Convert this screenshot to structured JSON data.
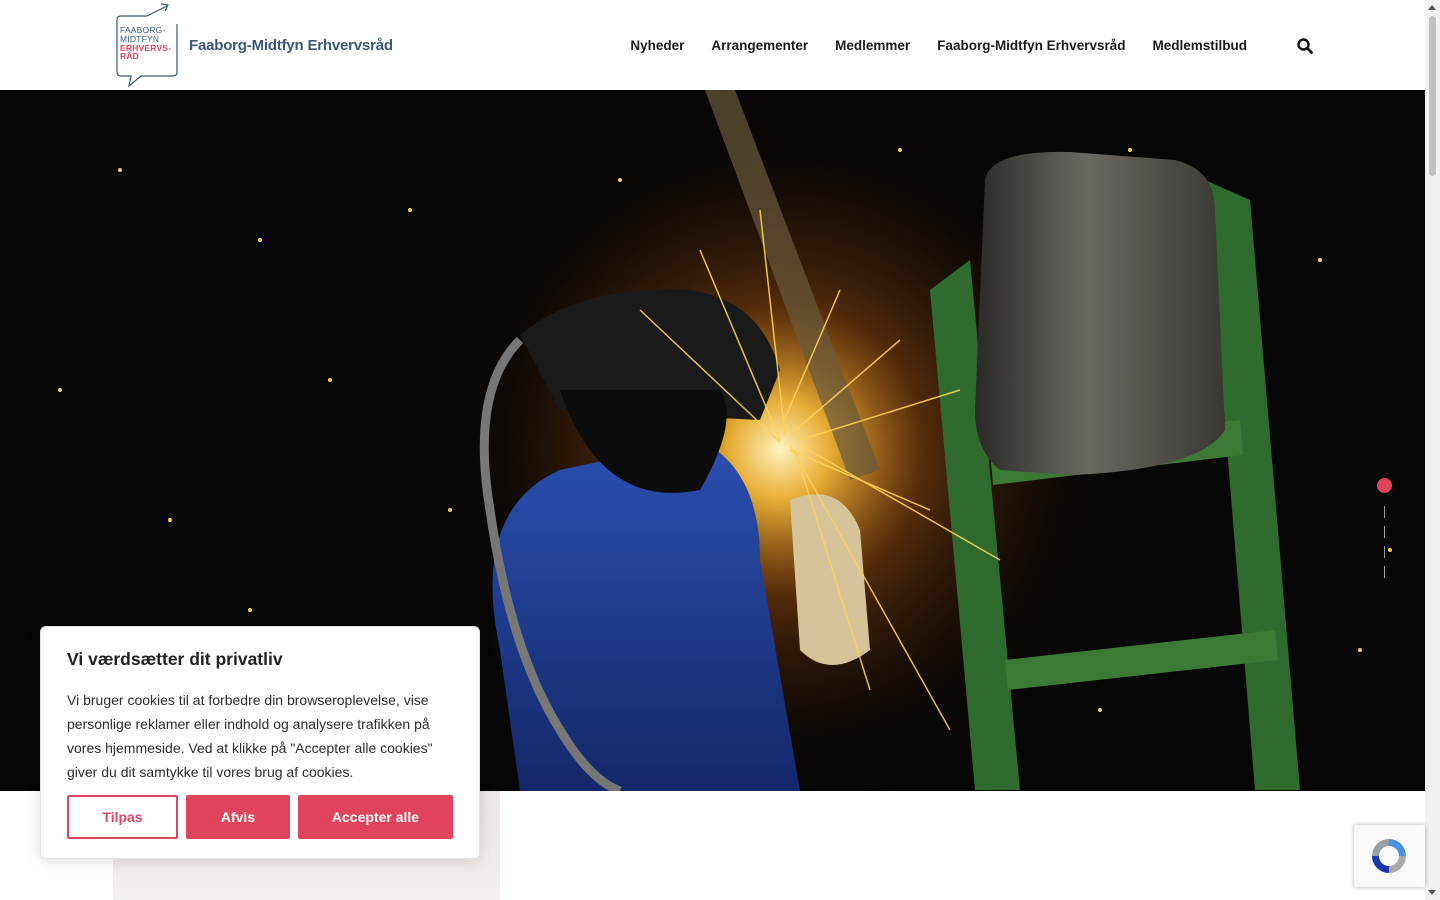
{
  "header": {
    "logo_lines": [
      "FAABORG-",
      "MIDTFYN",
      "ERHVERVS-",
      "RÅD"
    ],
    "site_name": "Faaborg-Midtfyn Erhvervsråd",
    "nav": [
      {
        "label": "Nyheder"
      },
      {
        "label": "Arrangementer"
      },
      {
        "label": "Medlemmer"
      },
      {
        "label": "Faaborg-Midtfyn Erhvervsråd"
      },
      {
        "label": "Medlemstilbud"
      }
    ],
    "search_icon": "search-icon"
  },
  "hero": {
    "image_icon": "welder-grinding-sparks-photo",
    "slider": {
      "active_slide": 1,
      "total_slides": 4
    }
  },
  "cookie_banner": {
    "title": "Vi værdsætter dit privatliv",
    "text": "Vi bruger cookies til at forbedre din browseroplevelse, vise personlige reklamer eller indhold og analysere trafikken på vores hjemmeside. Ved at klikke på \"Accepter alle cookies\" giver du dit samtykke til vores brug af cookies.",
    "buttons": {
      "customize": "Tilpas",
      "reject": "Afvis",
      "accept": "Accepter alle"
    }
  },
  "colors": {
    "accent": "#e0445c",
    "brand_blue": "#3b5873"
  }
}
